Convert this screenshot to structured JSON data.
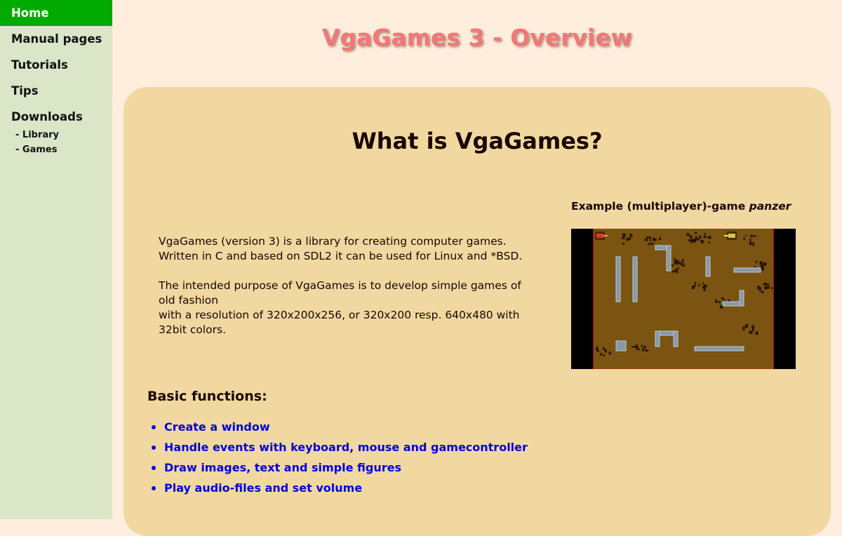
{
  "sidebar": {
    "items": [
      {
        "label": "Home",
        "active": true
      },
      {
        "label": "Manual pages"
      },
      {
        "label": "Tutorials"
      },
      {
        "label": "Tips"
      },
      {
        "label": "Downloads"
      }
    ],
    "downloads_sub": [
      "- Library",
      "- Games"
    ]
  },
  "header": {
    "title": "VgaGames 3 - Overview"
  },
  "main": {
    "heading": "What is VgaGames?",
    "intro": [
      "VgaGames (version 3) is a library for creating computer games.",
      "Written in C and based on SDL2 it can be used for Linux and *BSD.",
      "The intended purpose of VgaGames is to develop simple games of old fashion",
      "with a resolution of 320x200x256, or 320x200 resp. 640x480 with 32bit colors."
    ],
    "example": {
      "caption": "Example (multiplayer)-game ",
      "caption_em": "panzer",
      "image_icon": "game-screenshot"
    },
    "functions_heading": "Basic functions:",
    "functions": [
      "Create a window",
      "Handle events with keyboard, mouse and gamecontroller",
      "Draw images, text and simple figures",
      "Play audio-files and set volume"
    ]
  },
  "colors": {
    "background": "#ffeedd",
    "sidebar": "#dbe5c8",
    "active_nav": "#00aa00",
    "panel": "#f0d8a0",
    "title": "#f07878",
    "link": "#0000dd",
    "game_ground": "#7a5410"
  }
}
